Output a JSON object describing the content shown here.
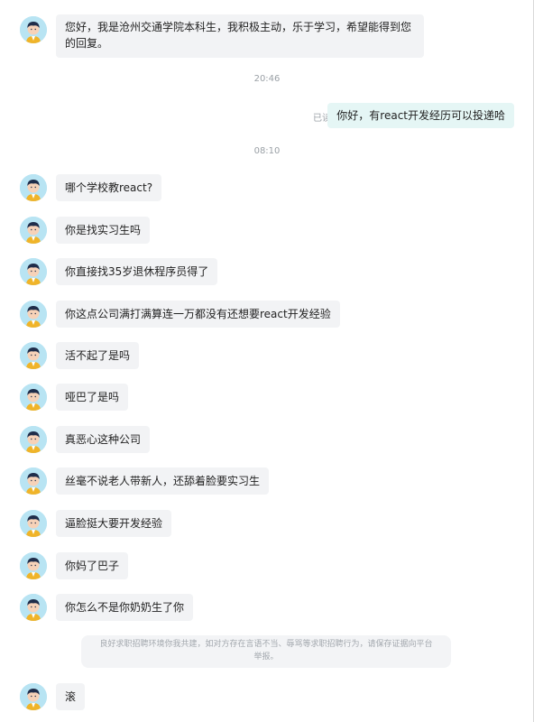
{
  "messages": [
    {
      "text": "您好，我是沧州交通学院本科生，我积极主动，乐于学习，希望能得到您的回复。"
    },
    {
      "time": "20:46"
    },
    {
      "self_text": "你好，有react开发经历可以投递哈",
      "status": "已读"
    },
    {
      "time": "08:10"
    },
    {
      "text": "哪个学校教react?"
    },
    {
      "text": "你是找实习生吗"
    },
    {
      "text": "你直接找35岁退休程序员得了"
    },
    {
      "text": "你这点公司满打满算连一万都没有还想要react开发经验"
    },
    {
      "text": "活不起了是吗"
    },
    {
      "text": "哑巴了是吗"
    },
    {
      "text": "真恶心这种公司"
    },
    {
      "text": "丝毫不说老人带新人，还舔着脸要实习生"
    },
    {
      "text": "逼脸挺大要开发经验"
    },
    {
      "text": "你妈了巴子"
    },
    {
      "text": "你怎么不是你奶奶生了你"
    },
    {
      "notice": "良好求职招聘环境你我共建，如对方存在言语不当、辱骂等求职招聘行为，请保存证据向平台举报。"
    },
    {
      "text": "滚"
    }
  ],
  "colors": {
    "incoming_bubble": "#f2f3f5",
    "outgoing_bubble": "#e5f6f5",
    "avatar_bg": "#b8e4f3",
    "muted_text": "#9aa0a6"
  }
}
